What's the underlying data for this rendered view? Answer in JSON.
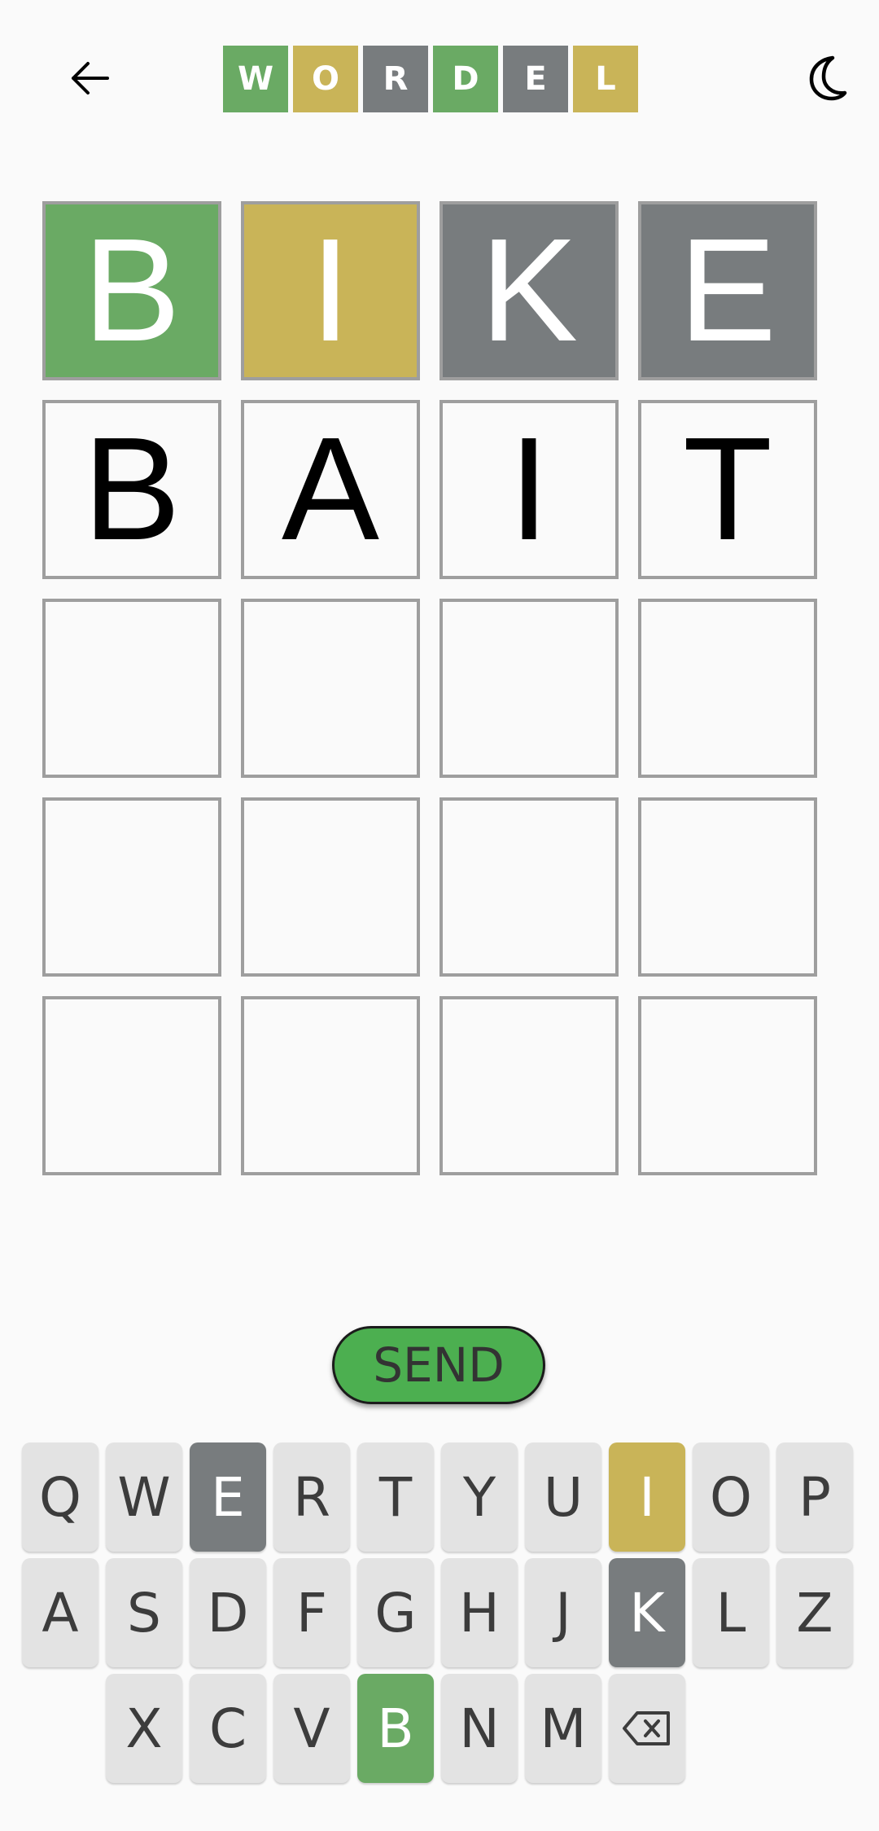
{
  "header": {
    "back_icon": "arrow-left-icon",
    "theme_icon": "moon-icon",
    "logo": [
      {
        "letter": "W",
        "color": "#6aaa64"
      },
      {
        "letter": "O",
        "color": "#c9b458"
      },
      {
        "letter": "R",
        "color": "#787c7e"
      },
      {
        "letter": "D",
        "color": "#6aaa64"
      },
      {
        "letter": "E",
        "color": "#787c7e"
      },
      {
        "letter": "L",
        "color": "#c9b458"
      }
    ]
  },
  "board": {
    "rows": [
      [
        {
          "letter": "B",
          "state": "green"
        },
        {
          "letter": "I",
          "state": "yellow"
        },
        {
          "letter": "K",
          "state": "gray"
        },
        {
          "letter": "E",
          "state": "gray"
        }
      ],
      [
        {
          "letter": "B",
          "state": "empty"
        },
        {
          "letter": "A",
          "state": "empty"
        },
        {
          "letter": "I",
          "state": "empty"
        },
        {
          "letter": "T",
          "state": "empty"
        }
      ],
      [
        {
          "letter": "",
          "state": "empty"
        },
        {
          "letter": "",
          "state": "empty"
        },
        {
          "letter": "",
          "state": "empty"
        },
        {
          "letter": "",
          "state": "empty"
        }
      ],
      [
        {
          "letter": "",
          "state": "empty"
        },
        {
          "letter": "",
          "state": "empty"
        },
        {
          "letter": "",
          "state": "empty"
        },
        {
          "letter": "",
          "state": "empty"
        }
      ],
      [
        {
          "letter": "",
          "state": "empty"
        },
        {
          "letter": "",
          "state": "empty"
        },
        {
          "letter": "",
          "state": "empty"
        },
        {
          "letter": "",
          "state": "empty"
        }
      ]
    ]
  },
  "send_label": "SEND",
  "keyboard": {
    "rows": [
      [
        {
          "key": "Q"
        },
        {
          "key": "W"
        },
        {
          "key": "E",
          "state": "gray"
        },
        {
          "key": "R"
        },
        {
          "key": "T"
        },
        {
          "key": "Y"
        },
        {
          "key": "U"
        },
        {
          "key": "I",
          "state": "yellow"
        },
        {
          "key": "O"
        },
        {
          "key": "P"
        }
      ],
      [
        {
          "key": "A"
        },
        {
          "key": "S"
        },
        {
          "key": "D"
        },
        {
          "key": "F"
        },
        {
          "key": "G"
        },
        {
          "key": "H"
        },
        {
          "key": "J"
        },
        {
          "key": "K",
          "state": "gray"
        },
        {
          "key": "L"
        },
        {
          "key": "Z"
        }
      ],
      [
        {
          "key": "X"
        },
        {
          "key": "C"
        },
        {
          "key": "V"
        },
        {
          "key": "B",
          "state": "green"
        },
        {
          "key": "N"
        },
        {
          "key": "M"
        },
        {
          "key": "",
          "icon": "backspace-icon"
        }
      ]
    ]
  }
}
